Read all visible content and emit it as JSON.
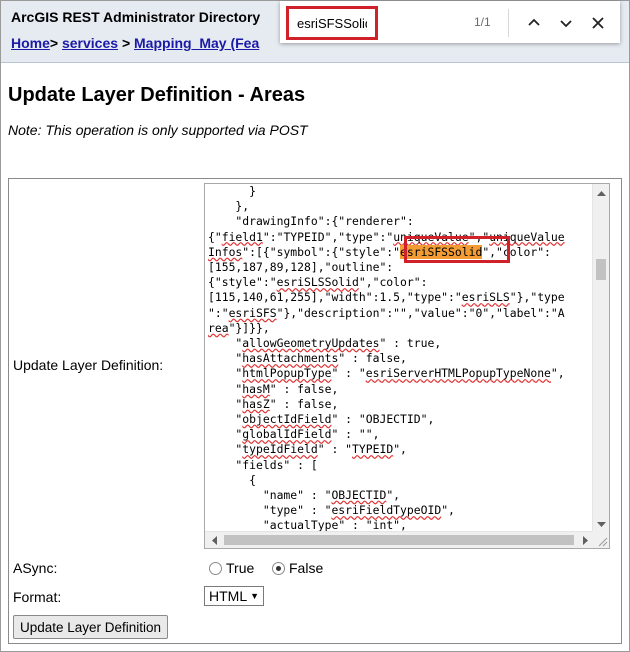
{
  "header": {
    "app_title": "ArcGIS REST Administrator Directory",
    "breadcrumb": {
      "home": "Home",
      "sep": ">",
      "services": "services",
      "mapping": "Mapping_May (Fea"
    }
  },
  "find_bar": {
    "query": "esriSFSSolid",
    "match_count": "1/1",
    "icons": {
      "previous": "chevron-up-icon",
      "next": "chevron-down-icon",
      "close": "close-icon"
    }
  },
  "page": {
    "title": "Update Layer Definition - Areas",
    "note": "Note: This operation is only supported via POST"
  },
  "form": {
    "definition_label": "Update Layer Definition:",
    "async_label": "ASync:",
    "async_options": [
      "True",
      "False"
    ],
    "async_selected": "False",
    "format_label": "Format:",
    "format_value": "HTML",
    "submit_label": "Update Layer Definition"
  },
  "highlight_color": "#f39c34",
  "callout_color": "#d0202a"
}
